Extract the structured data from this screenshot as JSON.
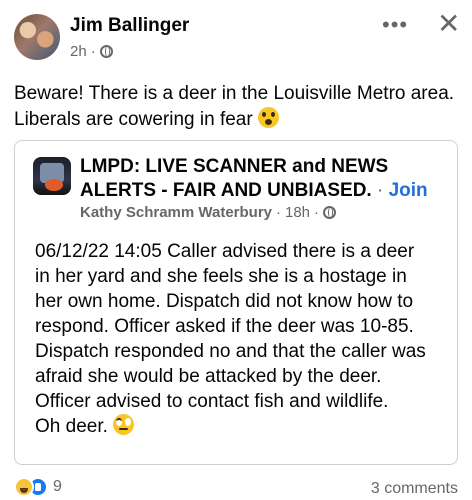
{
  "post": {
    "author": "Jim Ballinger",
    "time": "2h",
    "privacy_icon": "globe-icon",
    "text": "Beware! There is a deer in the Louisville Metro area. Liberals are cowering in fear",
    "text_emoji": "shocked-face-emoji"
  },
  "header_actions": {
    "more_label": "•••",
    "close_label": "✕"
  },
  "shared": {
    "group_name": "LMPD: LIVE SCANNER and NEWS ALERTS - FAIR AND UNBIASED.",
    "separator": " · ",
    "join_label": "Join",
    "poster": "Kathy Schramm Waterbury",
    "time": "18h",
    "text_lines": [
      "06/12/22 14:05 Caller advised there is a deer",
      "in her yard and she feels she is a hostage in",
      "her own home. Dispatch did not know how to",
      "respond. Officer asked if the deer was 10-85.",
      "Dispatch responded no and that the caller was",
      "afraid she would be attacked by the deer.",
      "Officer advised to contact fish and wildlife.",
      "Oh deer."
    ],
    "text_emoji": "eye-roll-emoji"
  },
  "footer": {
    "reaction_icons": [
      "haha-reaction-icon",
      "like-reaction-icon"
    ],
    "reaction_count": "9",
    "comments_label": "3 comments"
  },
  "colors": {
    "link": "#216fdb",
    "secondary_text": "#65676b",
    "border": "#ced0d4"
  }
}
